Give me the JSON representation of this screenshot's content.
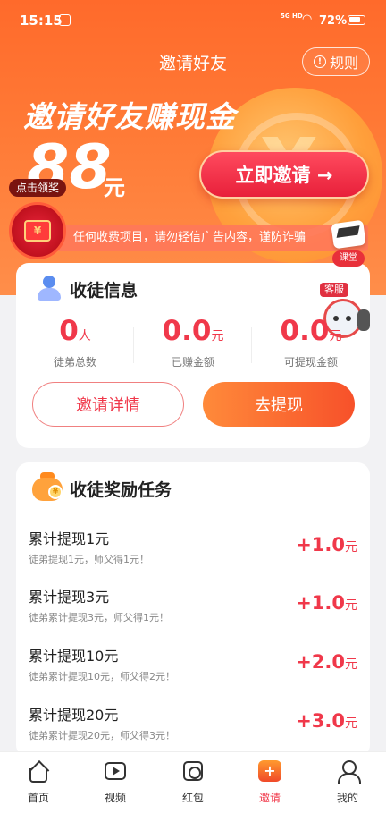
{
  "status_bar": {
    "time": "15:15",
    "signal": "5G HD",
    "battery": "72%"
  },
  "header": {
    "title": "邀请好友",
    "rules_label": "规则"
  },
  "hero": {
    "headline": "邀请好友赚现金",
    "amount": "88",
    "amount_unit": "元",
    "invite_button": "立即邀请 →",
    "notice": "任何收费项目，请勿轻信广告内容，谨防诈骗",
    "redpack_badge": "点击领奖",
    "redpack_glyph": "¥",
    "class_label": "课堂"
  },
  "apprentice_info": {
    "title": "收徒信息",
    "service_label": "客服",
    "stats": [
      {
        "value": "0",
        "unit": "人",
        "label": "徒弟总数"
      },
      {
        "value": "0.0",
        "unit": "元",
        "label": "已赚金额"
      },
      {
        "value": "0.0",
        "unit": "元",
        "label": "可提现金额"
      }
    ],
    "detail_button": "邀请详情",
    "withdraw_button": "去提现"
  },
  "reward_tasks": {
    "title": "收徒奖励任务",
    "coin_glyph": "¥",
    "items": [
      {
        "title": "累计提现1元",
        "desc": "徒弟提现1元，师父得1元！",
        "reward": "+1.0",
        "unit": "元"
      },
      {
        "title": "累计提现3元",
        "desc": "徒弟累计提现3元，师父得1元！",
        "reward": "+1.0",
        "unit": "元"
      },
      {
        "title": "累计提现10元",
        "desc": "徒弟累计提现10元，师父得2元！",
        "reward": "+2.0",
        "unit": "元"
      },
      {
        "title": "累计提现20元",
        "desc": "徒弟累计提现20元，师父得3元！",
        "reward": "+3.0",
        "unit": "元"
      }
    ]
  },
  "tabbar": [
    {
      "label": "首页",
      "icon": "home-icon"
    },
    {
      "label": "视频",
      "icon": "video-icon"
    },
    {
      "label": "红包",
      "icon": "redpacket-icon"
    },
    {
      "label": "邀请",
      "icon": "invite-icon",
      "active": true
    },
    {
      "label": "我的",
      "icon": "profile-icon"
    }
  ],
  "colors": {
    "brand_orange": "#ff6a2b",
    "accent_red": "#f0384a"
  }
}
